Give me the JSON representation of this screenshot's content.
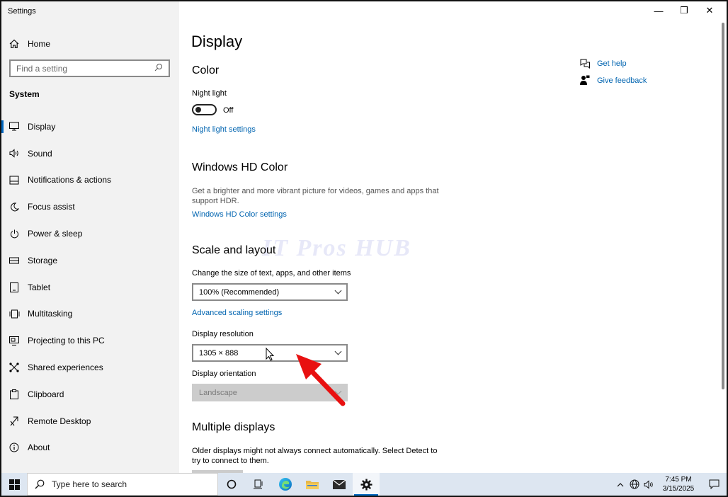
{
  "window": {
    "title": "Settings",
    "controls": {
      "minimize": "—",
      "restore": "❐",
      "close": "✕"
    }
  },
  "sidebar": {
    "home_label": "Home",
    "search_placeholder": "Find a setting",
    "section": "System",
    "items": [
      {
        "label": "Display",
        "icon": "monitor-icon",
        "selected": true
      },
      {
        "label": "Sound",
        "icon": "speaker-icon"
      },
      {
        "label": "Notifications & actions",
        "icon": "notification-icon"
      },
      {
        "label": "Focus assist",
        "icon": "moon-icon"
      },
      {
        "label": "Power & sleep",
        "icon": "power-icon"
      },
      {
        "label": "Storage",
        "icon": "storage-icon"
      },
      {
        "label": "Tablet",
        "icon": "tablet-icon"
      },
      {
        "label": "Multitasking",
        "icon": "multitasking-icon"
      },
      {
        "label": "Projecting to this PC",
        "icon": "projecting-icon"
      },
      {
        "label": "Shared experiences",
        "icon": "shared-icon"
      },
      {
        "label": "Clipboard",
        "icon": "clipboard-icon"
      },
      {
        "label": "Remote Desktop",
        "icon": "remote-desktop-icon"
      },
      {
        "label": "About",
        "icon": "info-icon"
      }
    ]
  },
  "main": {
    "title": "Display",
    "color": {
      "heading": "Color",
      "night_light_label": "Night light",
      "toggle_state": "Off",
      "night_light_link": "Night light settings"
    },
    "hd_color": {
      "heading": "Windows HD Color",
      "description": "Get a brighter and more vibrant picture for videos, games and apps that support HDR.",
      "link": "Windows HD Color settings"
    },
    "scale": {
      "heading": "Scale and layout",
      "size_label": "Change the size of text, apps, and other items",
      "size_value": "100% (Recommended)",
      "advanced_link": "Advanced scaling settings",
      "resolution_label": "Display resolution",
      "resolution_value": "1305 × 888",
      "orientation_label": "Display orientation",
      "orientation_value": "Landscape"
    },
    "multiple": {
      "heading": "Multiple displays",
      "description": "Older displays might not always connect automatically. Select Detect to try to connect to them."
    },
    "help": {
      "get_help": "Get help",
      "give_feedback": "Give feedback"
    },
    "watermark": "IT Pros HUB"
  },
  "taskbar": {
    "search_placeholder": "Type here to search",
    "time": "7:45 PM",
    "date": "3/15/2025"
  },
  "colors": {
    "accent": "#0067c0",
    "link": "#0064b0",
    "arrow": "#e81010"
  }
}
